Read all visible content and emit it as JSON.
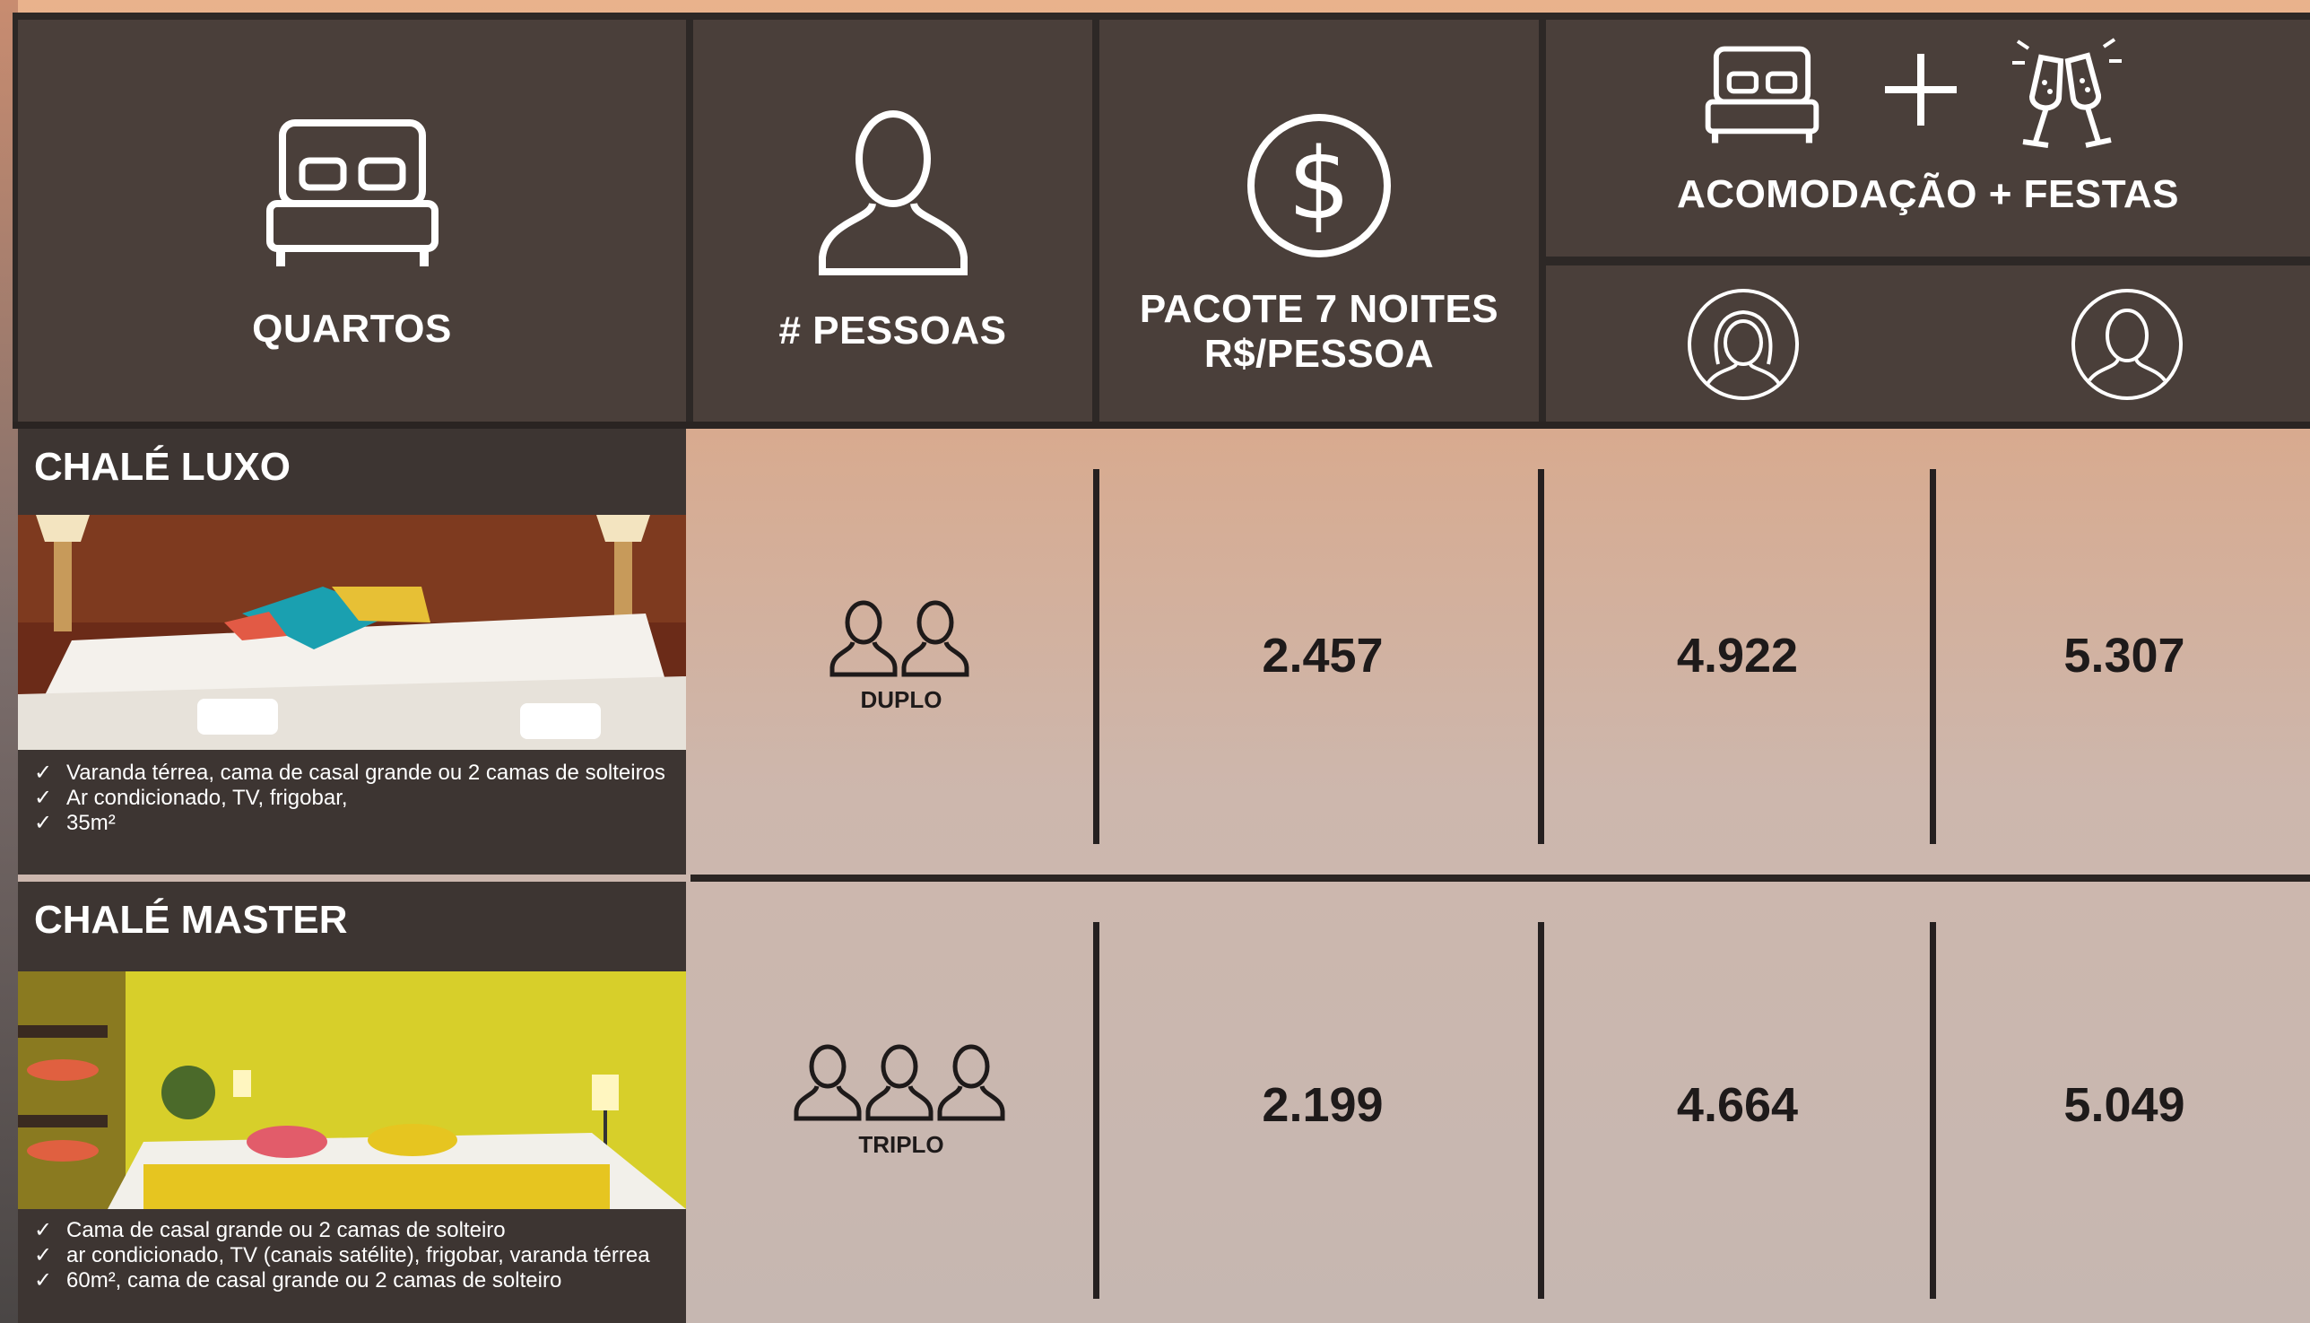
{
  "header": {
    "rooms_label": "QUARTOS",
    "rooms_icon": "bed-icon",
    "people_label": "# PESSOAS",
    "people_icon": "person-icon",
    "price_line1": "PACOTE 7 NOITES",
    "price_line2": "R$/PESSOA",
    "price_icon": "dollar-circle-icon",
    "combo_label": "ACOMODAÇÃO + FESTAS",
    "combo_icons": [
      "bed-icon",
      "plus-icon",
      "champagne-icon"
    ],
    "female_icon": "female-avatar-icon",
    "male_icon": "male-avatar-icon"
  },
  "rooms": [
    {
      "name": "CHALÉ LUXO",
      "features": [
        "Varanda térrea, cama de casal grande ou 2 camas de solteiros",
        "Ar condicionado, TV, frigobar,",
        "35m²"
      ],
      "occupancy": "DUPLO",
      "people_count": 2,
      "price": "2.457",
      "female_price": "4.922",
      "male_price": "5.307"
    },
    {
      "name": "CHALÉ MASTER",
      "features": [
        "Cama de casal grande ou 2 camas de solteiro",
        "ar condicionado, TV (canais satélite), frigobar, varanda térrea",
        "60m², cama de casal grande ou 2 camas de solteiro"
      ],
      "occupancy": "TRIPLO",
      "people_count": 3,
      "price": "2.199",
      "female_price": "4.664",
      "male_price": "5.049"
    }
  ],
  "colors": {
    "panel": "#4a3f3a",
    "card": "#3d3532",
    "text_dark": "#1e1a1a",
    "divider": "#252020"
  }
}
